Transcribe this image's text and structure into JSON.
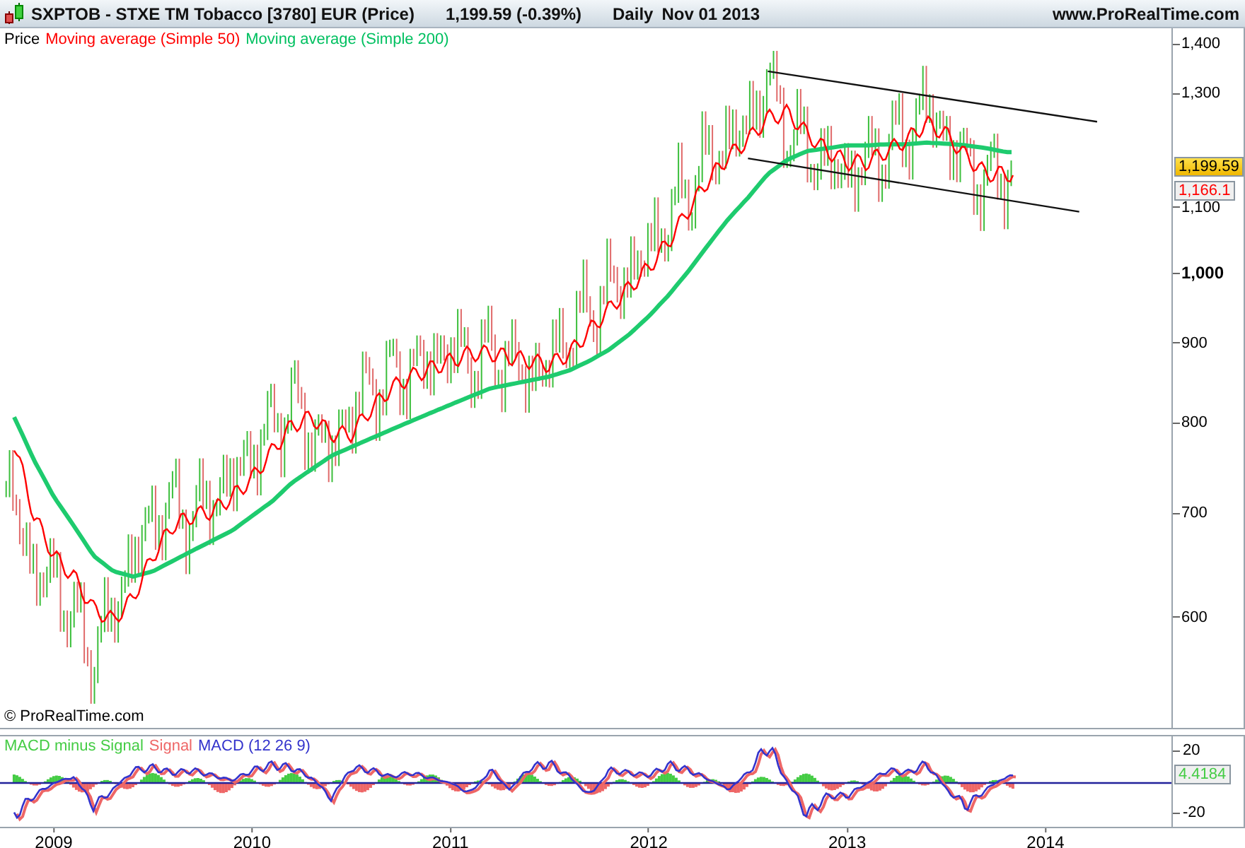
{
  "header": {
    "title": "SXPTOB - STXE TM Tobacco [3780] EUR (Price)",
    "quote": "1,199.59 (-0.39%)",
    "period": "Daily",
    "date": "Nov 01 2013",
    "site": "www.ProRealTime.com"
  },
  "price_panel": {
    "legend": [
      {
        "text": "Price",
        "color": "#000000"
      },
      {
        "text": "Moving average (Simple 50)",
        "color": "#ff0000"
      },
      {
        "text": "Moving average (Simple 200)",
        "color": "#00c060"
      }
    ],
    "axis_labels": [
      {
        "text": "1,400",
        "kind": "minor"
      },
      {
        "text": "1,300",
        "kind": "minor"
      },
      {
        "text": "1,100",
        "kind": "minor"
      },
      {
        "text": "1,000",
        "kind": "major"
      },
      {
        "text": "900",
        "kind": "minor"
      },
      {
        "text": "800",
        "kind": "minor"
      },
      {
        "text": "700",
        "kind": "minor"
      },
      {
        "text": "600",
        "kind": "minor"
      }
    ],
    "last_price": "1,199.59",
    "average_value": "1,166.1",
    "copyright": "© ProRealTime.com"
  },
  "macd_panel": {
    "legend": [
      {
        "text": "MACD minus Signal",
        "color": "#44cc44"
      },
      {
        "text": "Signal",
        "color": "#ee6666"
      },
      {
        "text": "MACD (12 26 9)",
        "color": "#3333cc"
      }
    ],
    "axis_labels": [
      "20",
      "-20"
    ],
    "value": "4.4184"
  },
  "x_axis": {
    "labels": [
      "2009",
      "2010",
      "2011",
      "2012",
      "2013",
      "2014"
    ]
  }
}
